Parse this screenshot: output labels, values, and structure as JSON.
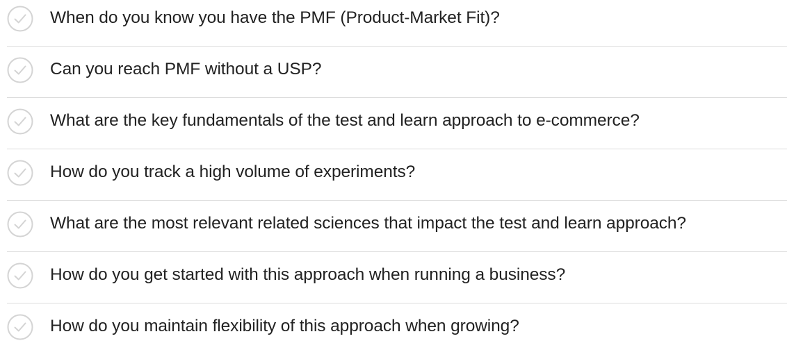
{
  "checklist": {
    "icon": "check-circle-icon",
    "icon_color": "#d4d4d4",
    "text_color": "#222222",
    "divider_color": "#dcdcdc",
    "items": [
      {
        "label": "When do you know you have the PMF (Product-Market Fit)?",
        "checked": false
      },
      {
        "label": "Can you reach PMF without a USP?",
        "checked": false
      },
      {
        "label": "What are the key fundamentals of the test and learn approach to e-commerce?",
        "checked": false
      },
      {
        "label": "How do you track a high volume of experiments?",
        "checked": false
      },
      {
        "label": "What are the most relevant related sciences that impact the test and learn approach?",
        "checked": false
      },
      {
        "label": "How do you get started with this approach when running a business?",
        "checked": false
      },
      {
        "label": "How do you maintain flexibility of this approach when growing?",
        "checked": false
      }
    ]
  }
}
